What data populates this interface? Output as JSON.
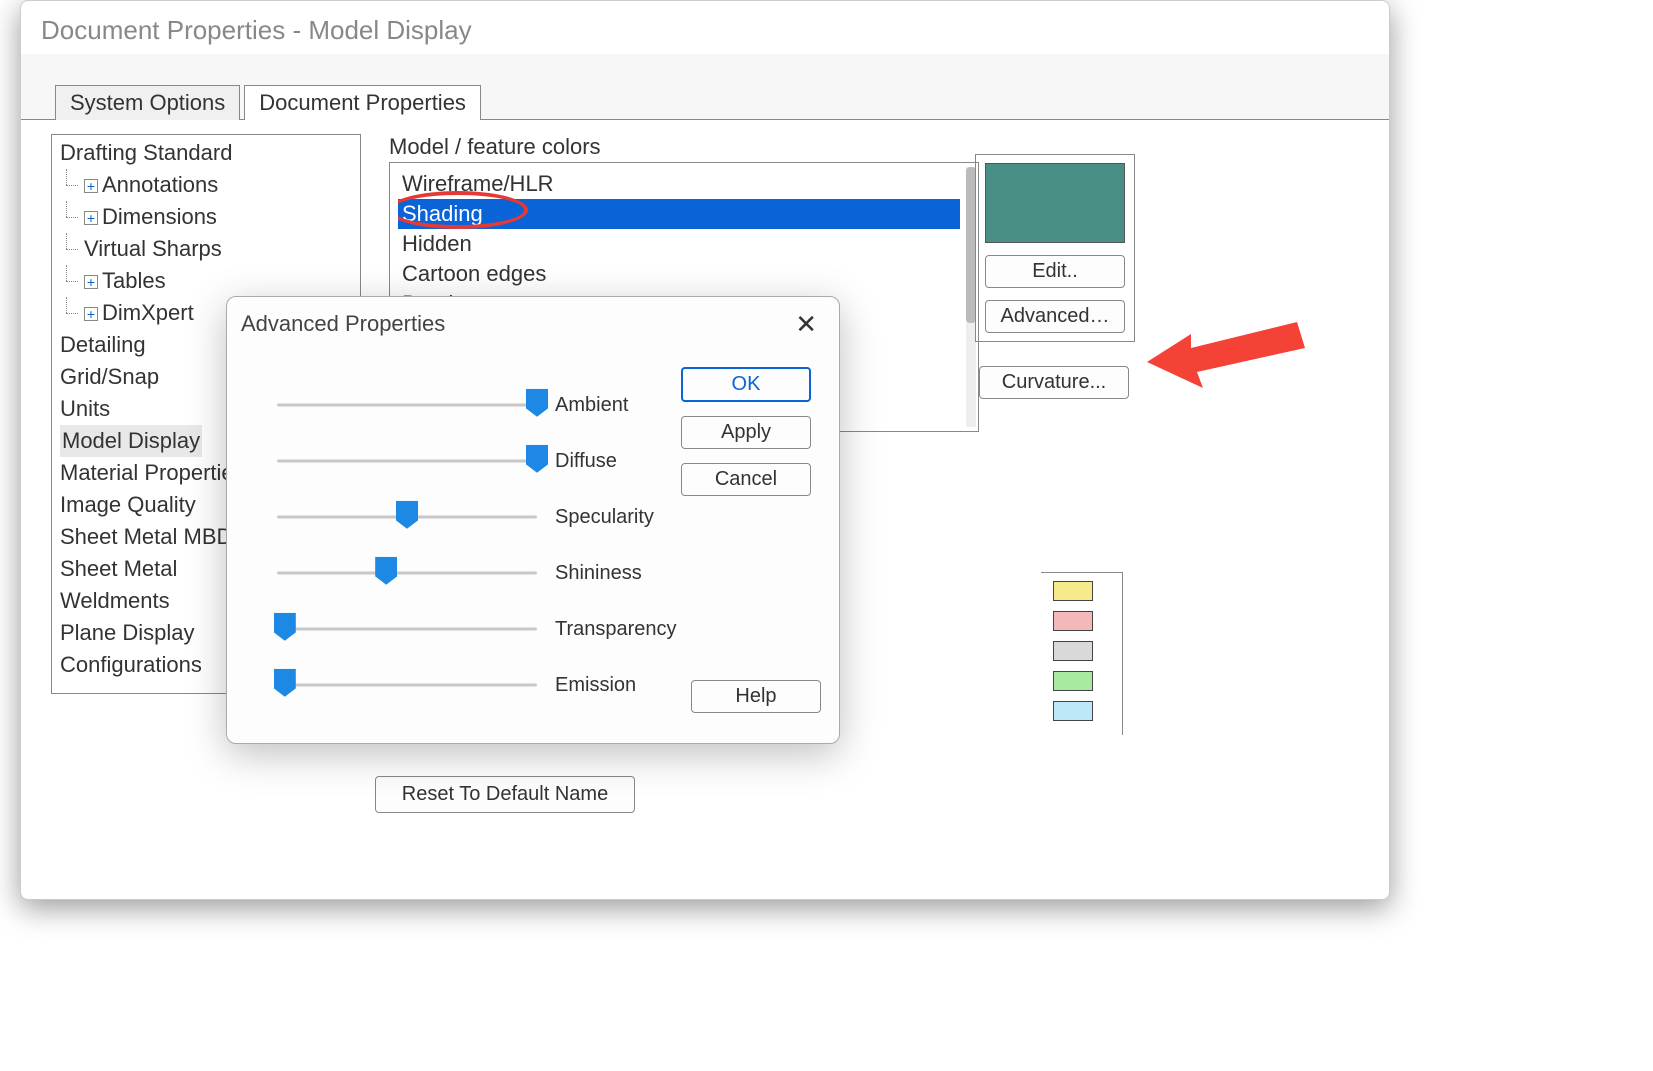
{
  "window": {
    "title": "Document Properties - Model Display"
  },
  "tabs": [
    {
      "label": "System Options",
      "active": false
    },
    {
      "label": "Document Properties",
      "active": true
    }
  ],
  "tree": {
    "root": "Drafting Standard",
    "children_expandable": [
      "Annotations",
      "Dimensions",
      "Virtual Sharps",
      "Tables",
      "DimXpert"
    ],
    "items": [
      "Detailing",
      "Grid/Snap",
      "Units",
      "Model Display",
      "Material Properties",
      "Image Quality",
      "Sheet Metal MBD",
      "Sheet Metal",
      "Weldments",
      "Plane Display",
      "Configurations"
    ],
    "selected": "Model Display"
  },
  "colors": {
    "group_label": "Model / feature colors",
    "items": [
      "Wireframe/HLR",
      "Shading",
      "Hidden",
      "Cartoon edges",
      "Bend"
    ],
    "selected": "Shading",
    "swatch_hex": "#4a8f85",
    "edit_label": "Edit..",
    "advanced_label": "Advanced…",
    "curvature_label": "Curvature...",
    "mini_swatches": [
      "#f7ea8a",
      "#f4b8b8",
      "#d9d9d9",
      "#a8eaa0",
      "#bde8f7"
    ]
  },
  "reset_label": "Reset To Default Name",
  "modal": {
    "title": "Advanced Properties",
    "sliders": [
      {
        "label": "Ambient",
        "value": 100
      },
      {
        "label": "Diffuse",
        "value": 100
      },
      {
        "label": "Specularity",
        "value": 50
      },
      {
        "label": "Shininess",
        "value": 42
      },
      {
        "label": "Transparency",
        "value": 3
      },
      {
        "label": "Emission",
        "value": 3
      }
    ],
    "ok": "OK",
    "apply": "Apply",
    "cancel": "Cancel",
    "help": "Help"
  }
}
